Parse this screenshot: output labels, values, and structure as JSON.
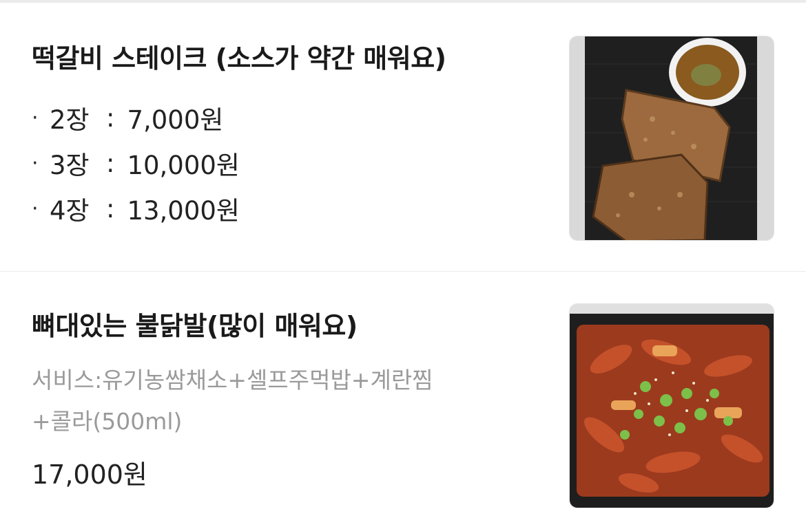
{
  "menu": {
    "items": [
      {
        "name": "떡갈비 스테이크 (소스가 약간 매워요)",
        "options": [
          {
            "bullet": "·",
            "qty": "2장",
            "sep": ":",
            "price": "7,000원"
          },
          {
            "bullet": "·",
            "qty": "3장",
            "sep": ":",
            "price": "10,000원"
          },
          {
            "bullet": "·",
            "qty": "4장",
            "sep": ":",
            "price": "13,000원"
          }
        ],
        "image_icon": "tteokgalbi-steak-photo"
      },
      {
        "name": "뼈대있는 불닭발(많이 매워요)",
        "description_lines": [
          "서비스:유기농쌈채소+셀프주먹밥+계란찜",
          "+콜라(500ml)"
        ],
        "price": "17,000원",
        "image_icon": "spicy-chicken-feet-photo"
      }
    ]
  },
  "colors": {
    "title": "#1a1a1a",
    "body": "#222222",
    "muted": "#9a9a9a",
    "divider": "#ececec"
  }
}
